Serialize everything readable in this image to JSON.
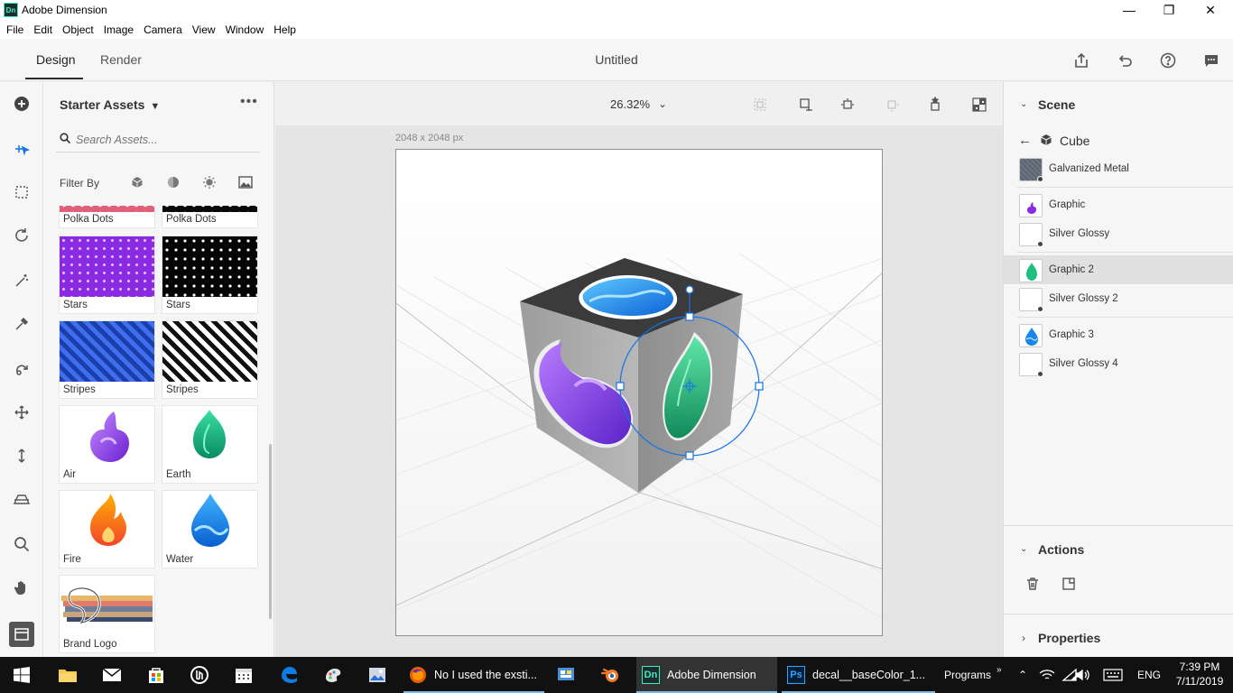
{
  "window": {
    "title": "Adobe Dimension",
    "app_badge": "Dn",
    "minimize": "—",
    "restore": "❐",
    "close": "✕"
  },
  "menu": [
    "File",
    "Edit",
    "Object",
    "Image",
    "Camera",
    "View",
    "Window",
    "Help"
  ],
  "header": {
    "tabs": [
      "Design",
      "Render"
    ],
    "active_tab": "Design",
    "document_title": "Untitled"
  },
  "assets": {
    "title": "Starter Assets",
    "more": "•••",
    "search_placeholder": "Search Assets...",
    "filter_label": "Filter By",
    "items": [
      {
        "label": "Polka Dots",
        "style": "polka-pink"
      },
      {
        "label": "Polka Dots",
        "style": "polka-black"
      },
      {
        "label": "Stars",
        "style": "stars-purple"
      },
      {
        "label": "Stars",
        "style": "stars-black"
      },
      {
        "label": "Stripes",
        "style": "stripes-blue"
      },
      {
        "label": "Stripes",
        "style": "stripes-black"
      },
      {
        "label": "Air",
        "style": "air"
      },
      {
        "label": "Earth",
        "style": "earth"
      },
      {
        "label": "Fire",
        "style": "fire"
      },
      {
        "label": "Water",
        "style": "water"
      },
      {
        "label": "Brand Logo",
        "style": "brand"
      }
    ]
  },
  "canvas": {
    "zoom": "26.32%",
    "document_size": "2048 x 2048 px"
  },
  "scene": {
    "title": "Scene",
    "object": "Cube",
    "items": [
      {
        "name": "Galvanized Metal",
        "swatch": "metal",
        "selected": false
      },
      {
        "name": "Graphic",
        "swatch": "air",
        "selected": false
      },
      {
        "name": "Silver Glossy",
        "swatch": "blank",
        "selected": false
      },
      {
        "name": "Graphic 2",
        "swatch": "earth",
        "selected": true
      },
      {
        "name": "Silver Glossy 2",
        "swatch": "blank",
        "selected": false
      },
      {
        "name": "Graphic 3",
        "swatch": "water",
        "selected": false
      },
      {
        "name": "Silver Glossy 4",
        "swatch": "blank",
        "selected": false
      }
    ],
    "actions_title": "Actions",
    "properties_title": "Properties"
  },
  "taskbar": {
    "apps": [
      {
        "label": "No I  used the exsti...",
        "badge": "firefox"
      },
      {
        "label": "Adobe Dimension",
        "badge": "Dn"
      },
      {
        "label": "decal__baseColor_1...",
        "badge": "Ps"
      }
    ],
    "programs": "Programs",
    "language": "ENG",
    "time": "7:39 PM",
    "date": "7/11/2019"
  },
  "colors": {
    "accent": "#1473e6",
    "selected_row": "#e0e0e0",
    "taskbar": "#111111"
  }
}
